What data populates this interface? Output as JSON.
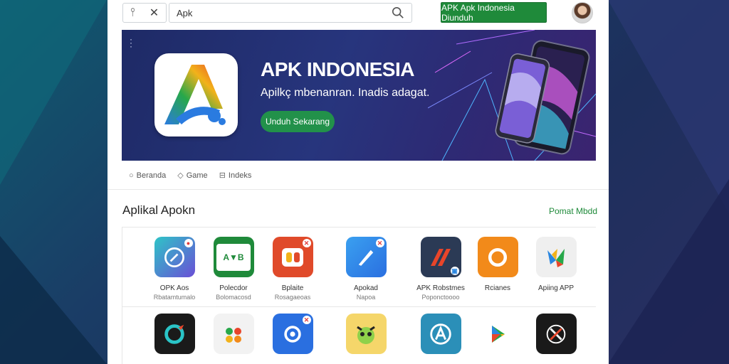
{
  "topbar": {
    "search_value": "Apk",
    "install_label": "APK Apk Indonesia Diunduh"
  },
  "hero": {
    "title": "APK INDONESIA",
    "subtitle": "Apilkç mbenanran. Inadis adagat.",
    "button_label": "Unduh Sekarang"
  },
  "chips": [
    {
      "icon": "circle-icon",
      "label": "Beranda"
    },
    {
      "icon": "tag-icon",
      "label": "Game"
    },
    {
      "icon": "grid-icon",
      "label": "Indeks"
    }
  ],
  "section": {
    "title": "Aplikal Apokn",
    "link": "Pomat Mbdd"
  },
  "apps_row1": [
    {
      "name": "OPK Aos",
      "sub": "Rbatamtumalo",
      "icon": "compass-icon",
      "color": "#2aa7c7"
    },
    {
      "name": "Polecdor",
      "sub": "Bolomacosd",
      "icon": "text-logo-icon",
      "color": "#1f8a3a"
    },
    {
      "name": "Bplaite",
      "sub": "Rosagaeoas",
      "icon": "puzzle-icon",
      "color": "#e04a2a"
    },
    {
      "name": "Apokad",
      "sub": "Napoa",
      "icon": "pencil-icon",
      "color": "#2a86e0"
    },
    {
      "name": "APK Robstmes",
      "sub": "Poponctoooo",
      "icon": "stripe-icon",
      "color": "#2b3a55"
    },
    {
      "name": "Rcianes",
      "sub": "",
      "icon": "ring-icon",
      "color": "#f28a1a"
    },
    {
      "name": "Apiing APP",
      "sub": "",
      "icon": "kite-icon",
      "color": "#efefef"
    }
  ],
  "apps_row2": [
    {
      "icon": "chat-icon",
      "color": "#1a1a1a"
    },
    {
      "icon": "dots-icon",
      "color": "#f2f2f2"
    },
    {
      "icon": "swirl-icon",
      "color": "#2a6fe0"
    },
    {
      "icon": "monster-icon",
      "color": "#f5d66a"
    },
    {
      "icon": "letter-a-icon",
      "color": "#2b8fb8"
    },
    {
      "icon": "play-icon",
      "color": "#ffffff"
    },
    {
      "icon": "tools-icon",
      "color": "#1a1a1a"
    }
  ]
}
